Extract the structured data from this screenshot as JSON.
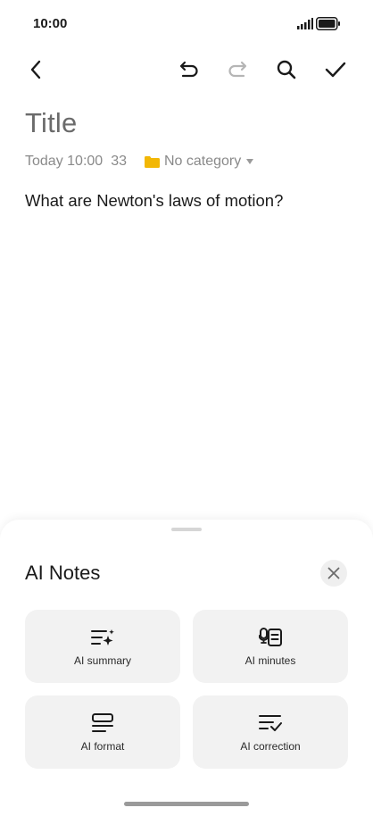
{
  "status_bar": {
    "time": "10:00"
  },
  "toolbar": {
    "back_icon": "chevron-left-icon",
    "undo_icon": "undo-icon",
    "redo_icon": "redo-icon",
    "search_icon": "search-icon",
    "confirm_icon": "check-icon"
  },
  "note": {
    "title": "Title",
    "date": "Today 10:00",
    "char_count": "33",
    "category": "No category",
    "body": "What are Newton's laws of motion?"
  },
  "sheet": {
    "title": "AI Notes",
    "tiles": [
      {
        "label": "AI summary",
        "icon": "ai-summary-icon"
      },
      {
        "label": "AI minutes",
        "icon": "ai-minutes-icon"
      },
      {
        "label": "AI format",
        "icon": "ai-format-icon"
      },
      {
        "label": "AI correction",
        "icon": "ai-correction-icon"
      }
    ]
  },
  "colors": {
    "folder": "#f2b705",
    "redo_disabled": "#b5b5b5",
    "tile_bg": "#f2f2f2"
  }
}
